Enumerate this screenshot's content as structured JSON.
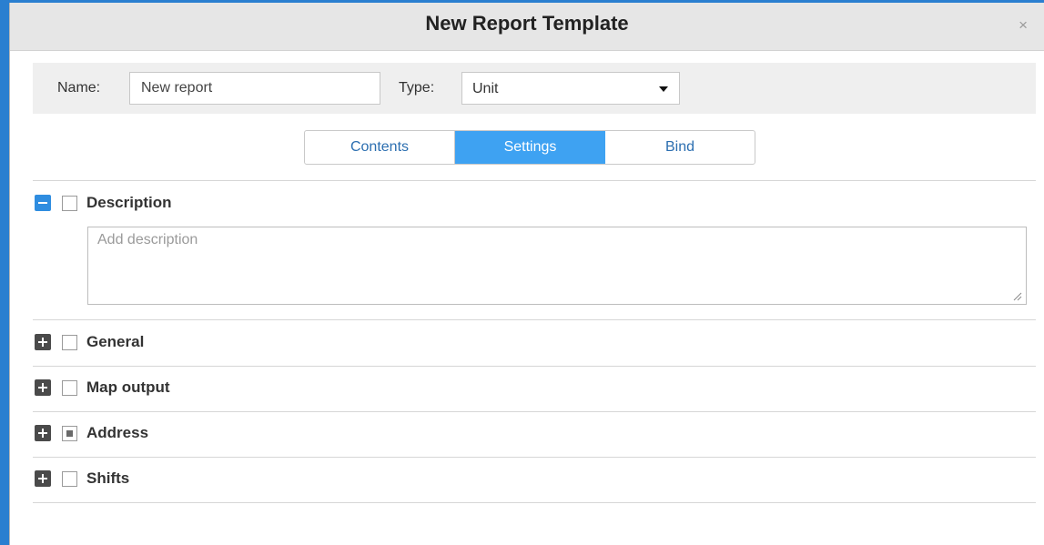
{
  "dialog": {
    "title": "New Report Template",
    "close_glyph": "×"
  },
  "form": {
    "name_label": "Name:",
    "name_value": "New report",
    "type_label": "Type:",
    "type_value": "Unit"
  },
  "tabs": [
    {
      "label": "Contents",
      "active": false
    },
    {
      "label": "Settings",
      "active": true
    },
    {
      "label": "Bind",
      "active": false
    }
  ],
  "sections": [
    {
      "label": "Description",
      "expanded": true,
      "checked": "none"
    },
    {
      "label": "General",
      "expanded": false,
      "checked": "none"
    },
    {
      "label": "Map output",
      "expanded": false,
      "checked": "none"
    },
    {
      "label": "Address",
      "expanded": false,
      "checked": "partial"
    },
    {
      "label": "Shifts",
      "expanded": false,
      "checked": "none"
    }
  ],
  "description": {
    "placeholder": "Add description",
    "value": ""
  },
  "colors": {
    "accent": "#3ea2f2",
    "tab_text": "#2b6eb0",
    "background": "#2a7fd0"
  }
}
